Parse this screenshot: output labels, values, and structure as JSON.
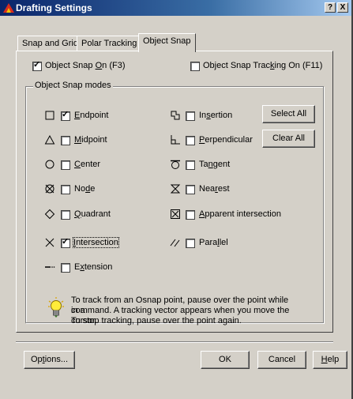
{
  "window": {
    "title": "Drafting Settings",
    "help_btn": "?",
    "close_btn": "X"
  },
  "tabs": [
    {
      "label": "Snap and Grid",
      "active": false
    },
    {
      "label": "Polar Tracking",
      "active": false
    },
    {
      "label": "Object Snap",
      "active": true
    }
  ],
  "top_options": {
    "snap_on": {
      "pre": "Object Snap ",
      "key": "O",
      "post": "n (F3)",
      "checked": true
    },
    "tracking_on": {
      "pre": "Object Snap Trac",
      "key": "k",
      "post": "ing On (F11)",
      "checked": false
    }
  },
  "group_label": "Object Snap modes",
  "modes_left": [
    {
      "symbol": "square-marker-icon",
      "pre": "",
      "key": "E",
      "post": "ndpoint",
      "checked": true
    },
    {
      "symbol": "triangle-marker-icon",
      "pre": "",
      "key": "M",
      "post": "idpoint",
      "checked": false
    },
    {
      "symbol": "circle-marker-icon",
      "pre": "",
      "key": "C",
      "post": "enter",
      "checked": false
    },
    {
      "symbol": "node-marker-icon",
      "pre": "No",
      "key": "d",
      "post": "e",
      "checked": false
    },
    {
      "symbol": "diamond-marker-icon",
      "pre": "",
      "key": "Q",
      "post": "uadrant",
      "checked": false
    },
    {
      "symbol": "x-marker-icon",
      "pre": "",
      "key": "I",
      "post": "ntersection",
      "checked": true
    },
    {
      "symbol": "extension-marker-icon",
      "pre": "E",
      "key": "x",
      "post": "tension",
      "checked": false
    }
  ],
  "modes_right": [
    {
      "symbol": "insertion-marker-icon",
      "pre": "In",
      "key": "s",
      "post": "ertion",
      "checked": false
    },
    {
      "symbol": "perpendicular-marker-icon",
      "pre": "",
      "key": "P",
      "post": "erpendicular",
      "checked": false
    },
    {
      "symbol": "tangent-marker-icon",
      "pre": "Ta",
      "key": "n",
      "post": "gent",
      "checked": false
    },
    {
      "symbol": "nearest-marker-icon",
      "pre": "Nea",
      "key": "r",
      "post": "est",
      "checked": false
    },
    {
      "symbol": "apparent-intersection-marker-icon",
      "pre": "",
      "key": "A",
      "post": "pparent intersection",
      "checked": false
    },
    {
      "symbol": "parallel-marker-icon",
      "pre": "Para",
      "key": "l",
      "post": "lel",
      "checked": false
    }
  ],
  "buttons_side": {
    "select_all": "Select All",
    "clear_all": "Clear All"
  },
  "tip": {
    "line1": "To track from an Osnap point, pause over the point while in a",
    "line2": "command.  A tracking vector appears when you move the cursor.",
    "line3": "To stop tracking, pause over the point again."
  },
  "bottom": {
    "options": {
      "pre": "Op",
      "key": "t",
      "post": "ions..."
    },
    "ok": "OK",
    "cancel": "Cancel",
    "help": {
      "pre": "",
      "key": "H",
      "post": "elp"
    }
  },
  "colors": {
    "face": "#d4d0c8",
    "title_start": "#0a246a",
    "title_end": "#a6caf0"
  }
}
